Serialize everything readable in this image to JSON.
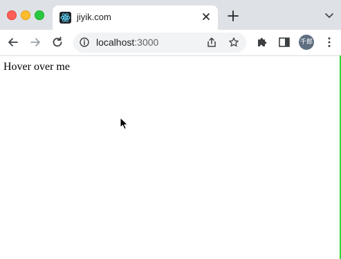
{
  "browser": {
    "tab": {
      "title": "jiyik.com",
      "favicon": "react-icon"
    },
    "toolbar": {
      "url_host": "localhost",
      "url_port": ":3000",
      "avatar_label": "千郎"
    },
    "colors": {
      "tabstrip_bg": "#dee1e6",
      "omnibox_bg": "#f1f3f4",
      "edge_accent": "#33d633"
    }
  },
  "page": {
    "text": "Hover over me"
  }
}
